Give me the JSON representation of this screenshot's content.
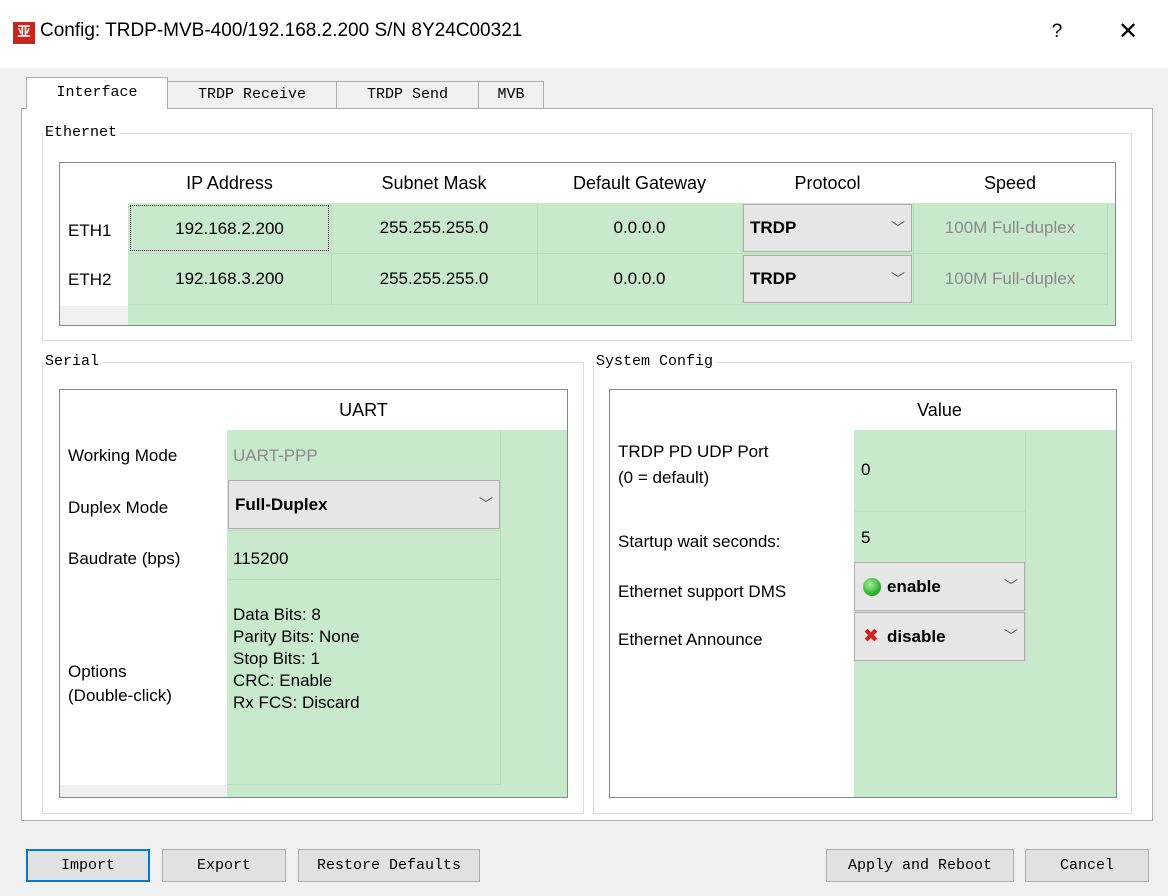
{
  "window": {
    "logo_char": "亚",
    "title": "Config: TRDP-MVB-400/192.168.2.200  S/N 8Y24C00321",
    "help": "?",
    "close": "✕"
  },
  "tabs": [
    {
      "label": "Interface",
      "active": true
    },
    {
      "label": "TRDP Receive"
    },
    {
      "label": "TRDP Send"
    },
    {
      "label": "MVB"
    }
  ],
  "ethernet": {
    "group_title": "Ethernet",
    "columns": [
      "IP Address",
      "Subnet Mask",
      "Default Gateway",
      "Protocol",
      "Speed"
    ],
    "rows": [
      {
        "name": "ETH1",
        "ip": "192.168.2.200",
        "mask": "255.255.255.0",
        "gateway": "0.0.0.0",
        "protocol": "TRDP",
        "speed": "100M Full-duplex"
      },
      {
        "name": "ETH2",
        "ip": "192.168.3.200",
        "mask": "255.255.255.0",
        "gateway": "0.0.0.0",
        "protocol": "TRDP",
        "speed": "100M Full-duplex"
      }
    ]
  },
  "serial": {
    "group_title": "Serial",
    "column": "UART",
    "working_mode_label": "Working Mode",
    "working_mode": "UART-PPP",
    "duplex_label": "Duplex Mode",
    "duplex": "Full-Duplex",
    "baud_label": "Baudrate (bps)",
    "baud": "115200",
    "options_label_1": "Options",
    "options_label_2": "(Double-click)",
    "options": [
      "Data Bits: 8",
      "Parity Bits: None",
      "Stop Bits: 1",
      "CRC: Enable",
      "Rx FCS: Discard"
    ]
  },
  "system": {
    "group_title": "System Config",
    "column": "Value",
    "udp_label_1": "TRDP PD UDP Port",
    "udp_label_2": "(0 = default)",
    "udp_value": "0",
    "wait_label": "Startup wait seconds:",
    "wait_value": "5",
    "dms_label": "Ethernet support DMS",
    "dms_value": "enable",
    "announce_label": "Ethernet Announce",
    "announce_value": "disable",
    "colors": {
      "enable": "#2db52d",
      "disable": "#d3211e"
    }
  },
  "buttons": {
    "import": "Import",
    "export": "Export",
    "restore": "Restore Defaults",
    "apply": "Apply and Reboot",
    "cancel": "Cancel"
  },
  "icons": {
    "combo_arrow": "chevron-down-icon",
    "enable": "green-dot-icon",
    "disable": "red-x-icon"
  }
}
